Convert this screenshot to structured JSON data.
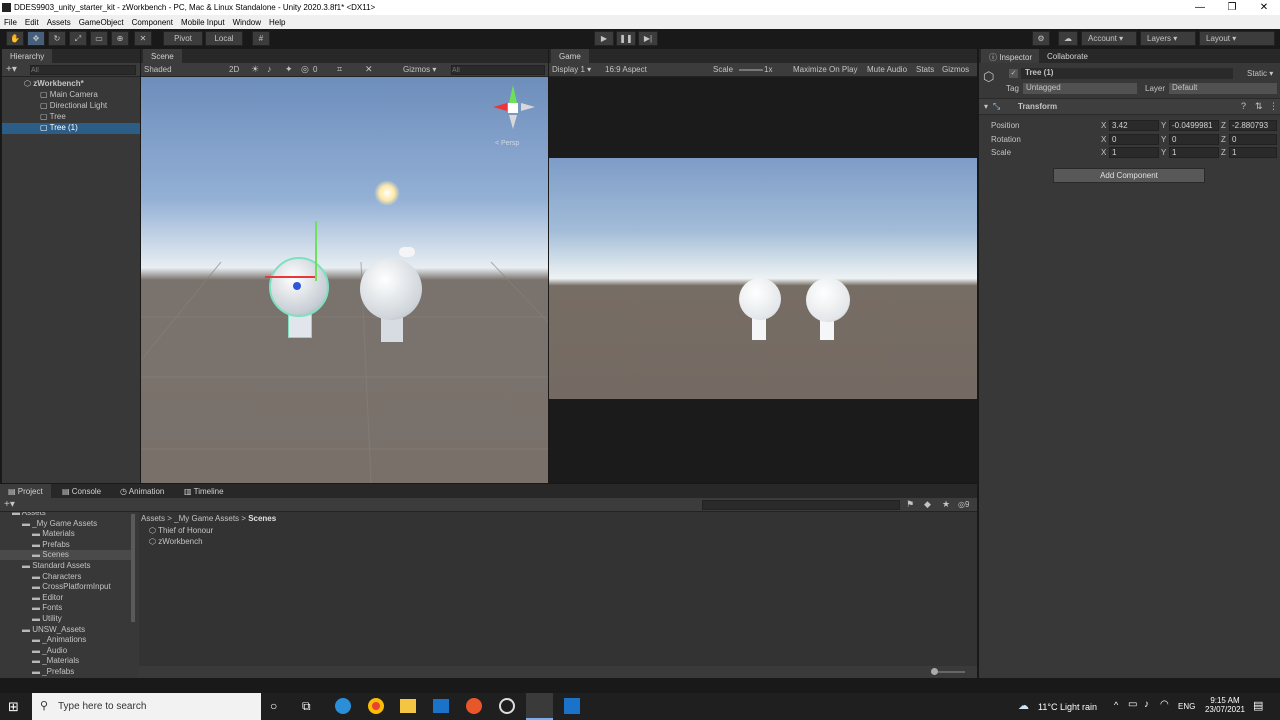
{
  "window": {
    "title": "DDES9903_unity_starter_kit - zWorkbench - PC, Mac & Linux Standalone - Unity 2020.3.8f1* <DX11>",
    "minimize": "—",
    "maximize": "❐",
    "close": "✕"
  },
  "menu": [
    "File",
    "Edit",
    "Assets",
    "GameObject",
    "Component",
    "Mobile Input",
    "Window",
    "Help"
  ],
  "toolbar": {
    "pivot": "Pivot",
    "local": "Local",
    "account": "Account",
    "layers": "Layers",
    "layout": "Layout"
  },
  "hierarchy": {
    "tab": "Hierarchy",
    "search_placeholder": "All",
    "scene_name": "zWorkbench*",
    "items": [
      "Main Camera",
      "Directional Light",
      "Tree",
      "Tree (1)"
    ]
  },
  "scene": {
    "tab": "Scene",
    "shading": "Shaded",
    "mode_2d": "2D",
    "fx_count": "0",
    "gizmos": "Gizmos",
    "search_placeholder": "All",
    "persp": "< Persp"
  },
  "game": {
    "tab": "Game",
    "display": "Display 1",
    "aspect": "16:9 Aspect",
    "scale_label": "Scale",
    "scale_value": "1x",
    "maximize": "Maximize On Play",
    "mute": "Mute Audio",
    "stats": "Stats",
    "gizmos": "Gizmos"
  },
  "inspector": {
    "tab": "Inspector",
    "tab2": "Collaborate",
    "object_name": "Tree (1)",
    "static_label": "Static",
    "tag_label": "Tag",
    "tag_value": "Untagged",
    "layer_label": "Layer",
    "layer_value": "Default",
    "component": "Transform",
    "position_label": "Position",
    "rotation_label": "Rotation",
    "scale_label": "Scale",
    "position": {
      "x": "3.42",
      "y": "-0.0499981",
      "z": "-2.880793"
    },
    "rotation": {
      "x": "0",
      "y": "0",
      "z": "0"
    },
    "scale": {
      "x": "1",
      "y": "1",
      "z": "1"
    },
    "add_component": "Add Component"
  },
  "project": {
    "tabs": [
      "Project",
      "Console",
      "Animation",
      "Timeline"
    ],
    "hidden_count": "9",
    "breadcrumb": [
      "Assets",
      "_My Game Assets",
      "Scenes"
    ],
    "tree": [
      {
        "label": "Assets",
        "indent": 0
      },
      {
        "label": "_My Game Assets",
        "indent": 1
      },
      {
        "label": "Materials",
        "indent": 2
      },
      {
        "label": "Prefabs",
        "indent": 2
      },
      {
        "label": "Scenes",
        "indent": 2
      },
      {
        "label": "Standard Assets",
        "indent": 1
      },
      {
        "label": "Characters",
        "indent": 2
      },
      {
        "label": "CrossPlatformInput",
        "indent": 2
      },
      {
        "label": "Editor",
        "indent": 2
      },
      {
        "label": "Fonts",
        "indent": 2
      },
      {
        "label": "Utility",
        "indent": 2
      },
      {
        "label": "UNSW_Assets",
        "indent": 1
      },
      {
        "label": "_Animations",
        "indent": 2
      },
      {
        "label": "_Audio",
        "indent": 2
      },
      {
        "label": "_Materials",
        "indent": 2
      },
      {
        "label": "_Prefabs",
        "indent": 2
      }
    ],
    "files": [
      "Thief of Honour",
      "zWorkbench"
    ]
  },
  "taskbar": {
    "search_placeholder": "Type here to search",
    "weather": "11°C  Light rain",
    "lang": "ENG",
    "time": "9:15 AM",
    "date": "23/07/2021"
  },
  "colors": {
    "selection": "#2c5d87",
    "panel": "#383838",
    "accent_blue": "#3a79bb"
  }
}
